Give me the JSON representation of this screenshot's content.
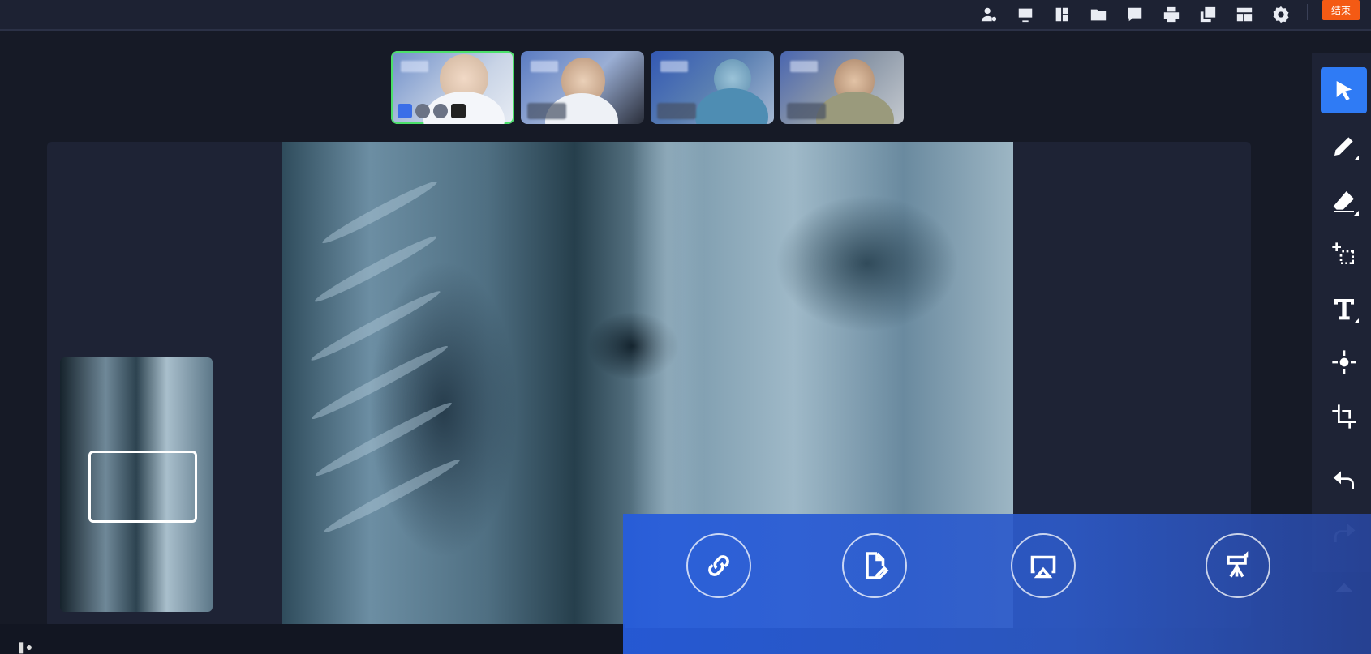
{
  "header": {
    "end_label": "结束",
    "icons": [
      "user-settings-icon",
      "screen-share-icon",
      "layout-icon",
      "folder-icon",
      "chat-icon",
      "printer-icon",
      "copy-icon",
      "dashboard-icon",
      "gear-icon"
    ]
  },
  "participants": [
    {
      "name_hidden": true,
      "active": true
    },
    {
      "name_hidden": true,
      "active": false
    },
    {
      "name_hidden": true,
      "active": false
    },
    {
      "name_hidden": true,
      "active": false
    }
  ],
  "tools": [
    "select",
    "pen",
    "eraser",
    "select-area",
    "text",
    "laser",
    "crop",
    "undo",
    "redo",
    "hide"
  ],
  "actions": [
    {
      "icon": "link-icon",
      "label": ""
    },
    {
      "icon": "edit-document-icon",
      "label": ""
    },
    {
      "icon": "airplay-icon",
      "label": ""
    },
    {
      "icon": "projector-icon",
      "label": ""
    }
  ],
  "colors": {
    "accent": "#2f7bf5",
    "end_button": "#f45a14",
    "active_border": "#4be06a"
  }
}
